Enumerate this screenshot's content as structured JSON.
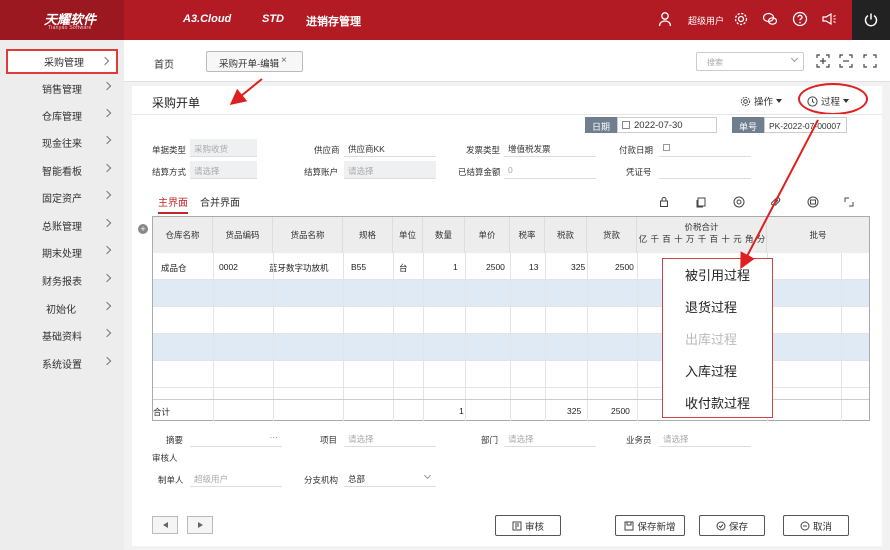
{
  "brand": {
    "name": "天耀软件",
    "subtitle": "Tianyao Software"
  },
  "topnav": {
    "product": "A3.Cloud",
    "edition": "STD",
    "module": "进销存管理",
    "user": "超级用户"
  },
  "sidebar": {
    "items": [
      {
        "label": "采购管理",
        "active": true
      },
      {
        "label": "销售管理"
      },
      {
        "label": "仓库管理"
      },
      {
        "label": "现金往来"
      },
      {
        "label": "智能看板"
      },
      {
        "label": "固定资产"
      },
      {
        "label": "总账管理"
      },
      {
        "label": "期末处理"
      },
      {
        "label": "财务报表"
      },
      {
        "label": "初始化"
      },
      {
        "label": "基础资料"
      },
      {
        "label": "系统设置"
      }
    ]
  },
  "tabs": {
    "home": "首页",
    "active": "采购开单-编辑",
    "close": "×"
  },
  "search": {
    "placeholder": "搜索"
  },
  "page": {
    "title": "采购开单",
    "operate": "操作",
    "process": "过程"
  },
  "header": {
    "date_label": "日期",
    "date": "2022-07-30",
    "no_label": "单号",
    "no": "PK-2022-07-00007"
  },
  "form": {
    "bill_type_label": "单据类型",
    "bill_type": "采购收货",
    "supplier_label": "供应商",
    "supplier": "供应商KK",
    "invoice_type_label": "发票类型",
    "invoice_type": "增值税发票",
    "pay_date_label": "付款日期",
    "settle_method_label": "结算方式",
    "settle_method": "请选择",
    "settle_account_label": "结算账户",
    "settle_account": "请选择",
    "settled_amount_label": "已结算金额",
    "settled_amount": "0",
    "voucher_label": "凭证号"
  },
  "subtabs": {
    "main": "主界面",
    "merge": "合并界面"
  },
  "grid": {
    "columns": [
      "仓库名称",
      "货品编码",
      "货品名称",
      "规格",
      "单位",
      "数量",
      "单价",
      "税率",
      "税款",
      "货款"
    ],
    "tax_total": "价税合计",
    "digit_units": [
      "亿",
      "千",
      "百",
      "十",
      "万",
      "千",
      "百",
      "十",
      "元",
      "角",
      "分"
    ],
    "batch": "批号",
    "row": {
      "warehouse": "成品仓",
      "code": "0002",
      "name": "蓝牙数字功放机",
      "spec": "B55",
      "unit": "台",
      "qty": "1",
      "price": "2500",
      "tax_rate": "13",
      "tax": "325",
      "amount": "2500"
    },
    "total": {
      "label": "合计",
      "qty": "1",
      "tax": "325",
      "amount": "2500"
    }
  },
  "process_menu": [
    {
      "label": "被引用过程"
    },
    {
      "label": "退货过程"
    },
    {
      "label": "出库过程",
      "disabled": true
    },
    {
      "label": "入库过程"
    },
    {
      "label": "收付款过程"
    }
  ],
  "footer": {
    "summary_label": "摘要",
    "summary_more": "···",
    "project_label": "项目",
    "project": "请选择",
    "dept_label": "部门",
    "dept": "请选择",
    "salesman_label": "业务员",
    "salesman": "请选择",
    "auditor_label": "审核人",
    "maker_label": "制单人",
    "maker": "超级用户",
    "branch_label": "分支机构",
    "branch": "总部"
  },
  "buttons": {
    "audit": "审核",
    "save_new": "保存新增",
    "save": "保存",
    "cancel": "取消"
  },
  "colors": {
    "brand_red": "#b31b24",
    "highlight": "#e02020",
    "row_alt": "#dfeaf4"
  }
}
